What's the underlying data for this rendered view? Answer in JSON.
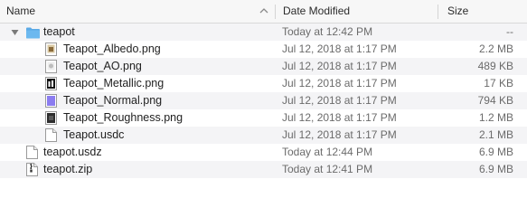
{
  "columns": {
    "name": "Name",
    "date": "Date Modified",
    "size": "Size"
  },
  "rows": [
    {
      "name": "teapot",
      "date": "Today at 12:42 PM",
      "size": "--",
      "type": "folder-icon"
    },
    {
      "name": "Teapot_Albedo.png",
      "date": "Jul 12, 2018 at 1:17 PM",
      "size": "2.2 MB",
      "type": "image-albedo-icon"
    },
    {
      "name": "Teapot_AO.png",
      "date": "Jul 12, 2018 at 1:17 PM",
      "size": "489 KB",
      "type": "image-ao-icon"
    },
    {
      "name": "Teapot_Metallic.png",
      "date": "Jul 12, 2018 at 1:17 PM",
      "size": "17 KB",
      "type": "image-metallic-icon"
    },
    {
      "name": "Teapot_Normal.png",
      "date": "Jul 12, 2018 at 1:17 PM",
      "size": "794 KB",
      "type": "image-normal-icon"
    },
    {
      "name": "Teapot_Roughness.png",
      "date": "Jul 12, 2018 at 1:17 PM",
      "size": "1.2 MB",
      "type": "image-roughness-icon"
    },
    {
      "name": "Teapot.usdc",
      "date": "Jul 12, 2018 at 1:17 PM",
      "size": "2.1 MB",
      "type": "document-icon"
    },
    {
      "name": "teapot.usdz",
      "date": "Today at 12:44 PM",
      "size": "6.9 MB",
      "type": "document-icon"
    },
    {
      "name": "teapot.zip",
      "date": "Today at 12:41 PM",
      "size": "6.9 MB",
      "type": "zip-icon"
    }
  ],
  "colors": {
    "folder": "#5aa9e6",
    "header_bg": "#f7f7f7",
    "alt_row": "#f4f4f6",
    "normal_map": "#8b7cf0"
  }
}
